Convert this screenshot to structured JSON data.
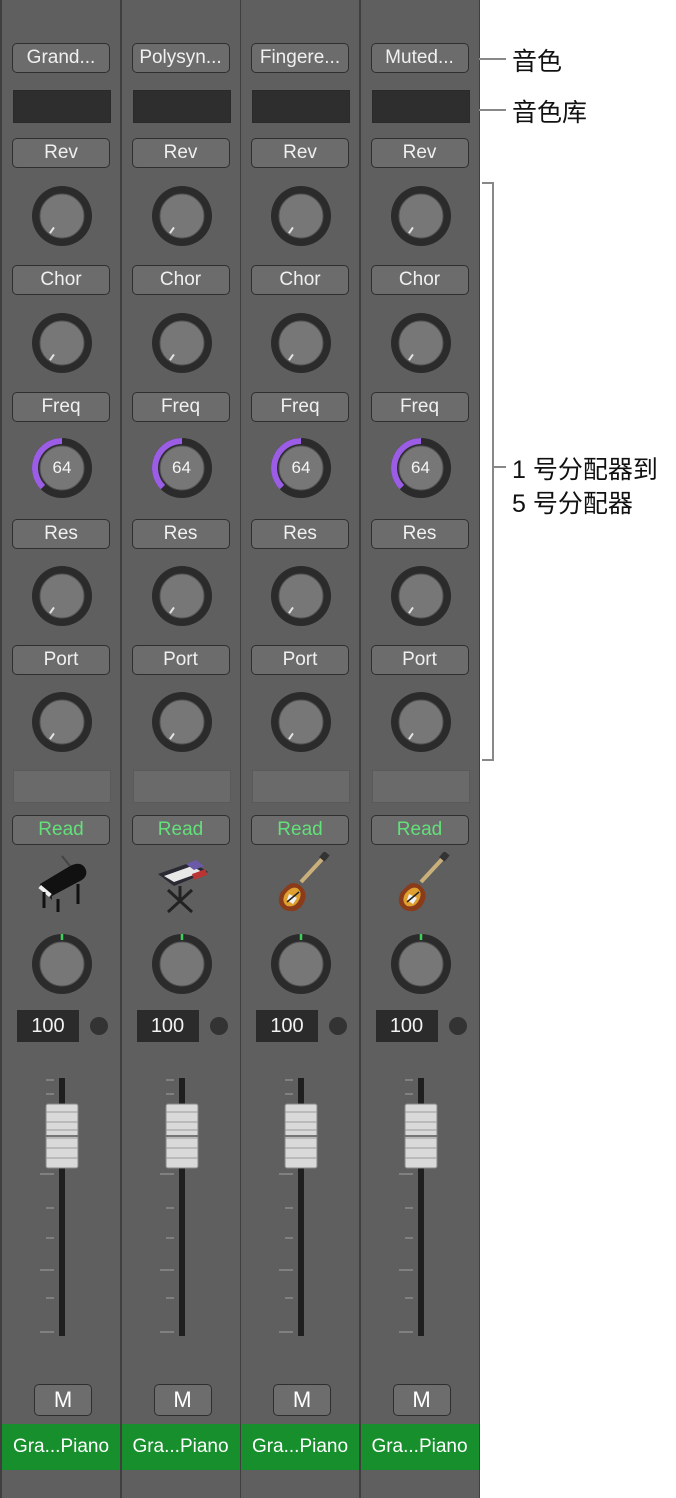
{
  "strips": [
    {
      "patch": "Grand...",
      "sends": [
        "Rev",
        "Chor",
        "Freq",
        "Res",
        "Port"
      ],
      "freq_value": "64",
      "automation": "Read",
      "instrument_icon": "grand-piano-icon",
      "volume": "100",
      "mute": "M",
      "track_name": "Gra...Piano"
    },
    {
      "patch": "Polysyn...",
      "sends": [
        "Rev",
        "Chor",
        "Freq",
        "Res",
        "Port"
      ],
      "freq_value": "64",
      "automation": "Read",
      "instrument_icon": "synthesizer-icon",
      "volume": "100",
      "mute": "M",
      "track_name": "Gra...Piano"
    },
    {
      "patch": "Fingere...",
      "sends": [
        "Rev",
        "Chor",
        "Freq",
        "Res",
        "Port"
      ],
      "freq_value": "64",
      "automation": "Read",
      "instrument_icon": "electric-guitar-icon",
      "volume": "100",
      "mute": "M",
      "track_name": "Gra...Piano"
    },
    {
      "patch": "Muted...",
      "sends": [
        "Rev",
        "Chor",
        "Freq",
        "Res",
        "Port"
      ],
      "freq_value": "64",
      "automation": "Read",
      "instrument_icon": "electric-guitar-icon",
      "volume": "100",
      "mute": "M",
      "track_name": "Gra...Piano"
    }
  ],
  "callouts": {
    "patch": "音色",
    "bank": "音色库",
    "sends_line1": "1 号分配器到",
    "sends_line2": "5 号分配器"
  },
  "colors": {
    "freq_arc": "#9b5de5",
    "read_text": "#63e07a",
    "track_name_bg": "#168f2c"
  }
}
